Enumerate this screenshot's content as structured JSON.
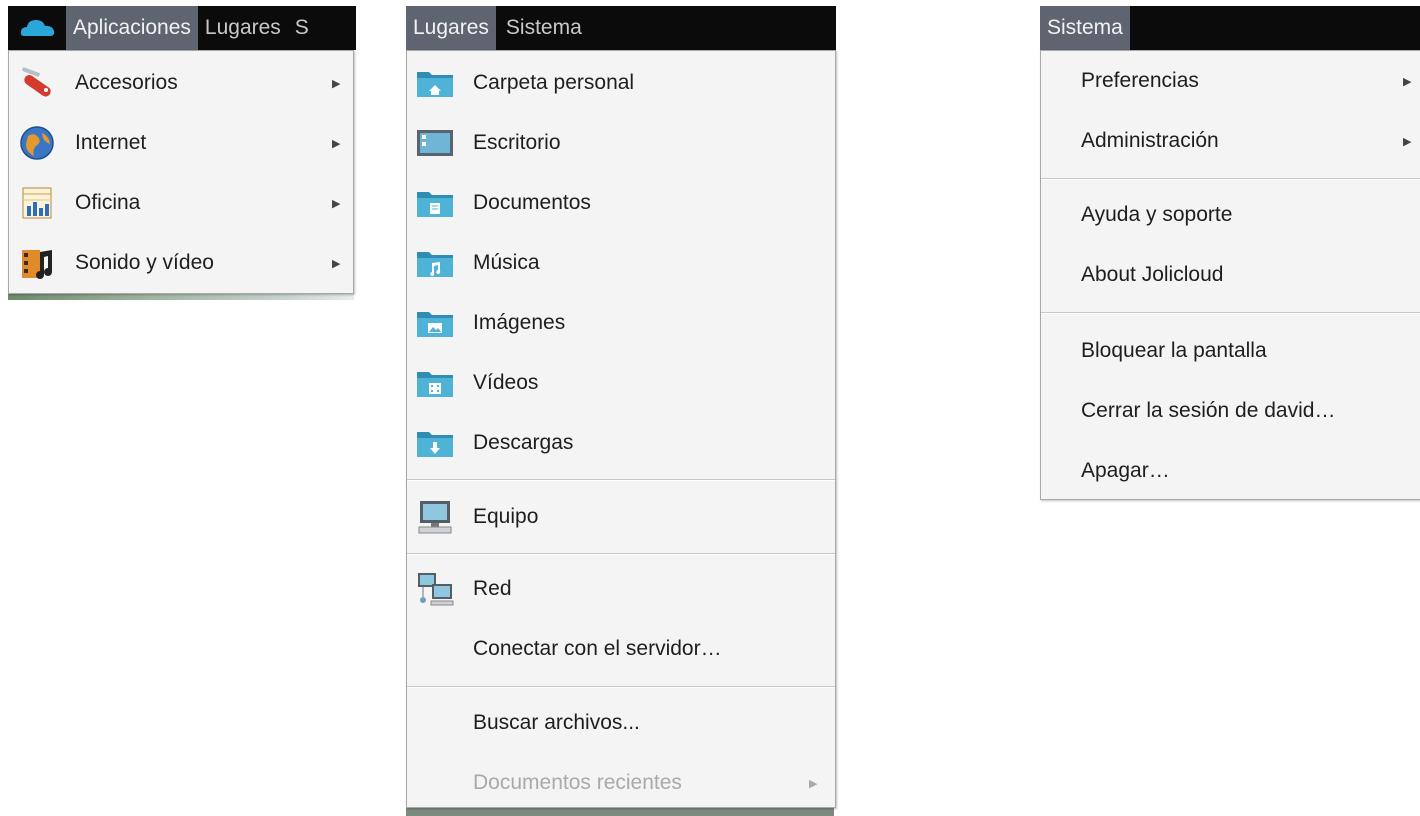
{
  "panel1": {
    "menubar": {
      "logo_icon": "cloud-icon",
      "items": [
        {
          "label": "Aplicaciones"
        },
        {
          "label": "Lugares"
        },
        {
          "label": "S"
        }
      ]
    },
    "menu": {
      "items": [
        {
          "label": "Accesorios",
          "icon": "accessories-icon"
        },
        {
          "label": "Internet",
          "icon": "internet-globe-icon"
        },
        {
          "label": "Oficina",
          "icon": "office-icon"
        },
        {
          "label": "Sonido y vídeo",
          "icon": "multimedia-icon"
        }
      ]
    }
  },
  "panel2": {
    "menubar": {
      "items": [
        {
          "label": "Lugares"
        },
        {
          "label": "Sistema"
        }
      ]
    },
    "menu": {
      "items": [
        {
          "label": "Carpeta personal",
          "icon": "home-folder-icon"
        },
        {
          "label": "Escritorio",
          "icon": "desktop-icon"
        },
        {
          "label": "Documentos",
          "icon": "documents-folder-icon"
        },
        {
          "label": "Música",
          "icon": "music-folder-icon"
        },
        {
          "label": "Imágenes",
          "icon": "pictures-folder-icon"
        },
        {
          "label": "Vídeos",
          "icon": "videos-folder-icon"
        },
        {
          "label": "Descargas",
          "icon": "downloads-folder-icon"
        },
        {
          "label": "Equipo",
          "icon": "computer-icon"
        },
        {
          "label": "Red",
          "icon": "network-icon"
        },
        {
          "label": "Conectar con el servidor…"
        },
        {
          "label": "Buscar archivos..."
        },
        {
          "label": "Documentos recientes",
          "disabled": true
        }
      ]
    }
  },
  "panel3": {
    "menubar": {
      "items": [
        {
          "label": "Sistema"
        }
      ]
    },
    "menu": {
      "items": [
        {
          "label": "Preferencias"
        },
        {
          "label": "Administración"
        },
        {
          "label": "Ayuda y soporte"
        },
        {
          "label": "About Jolicloud"
        },
        {
          "label": "Bloquear la pantalla"
        },
        {
          "label": "Cerrar la sesión de david…"
        },
        {
          "label": "Apagar…"
        }
      ]
    }
  },
  "colors": {
    "menubar_bg": "#0b0b0b",
    "menubar_active": "#5f6570",
    "menu_bg": "#f4f4f4",
    "folder_blue": "#3a9fc3",
    "disabled_text": "#a9a9a9"
  }
}
